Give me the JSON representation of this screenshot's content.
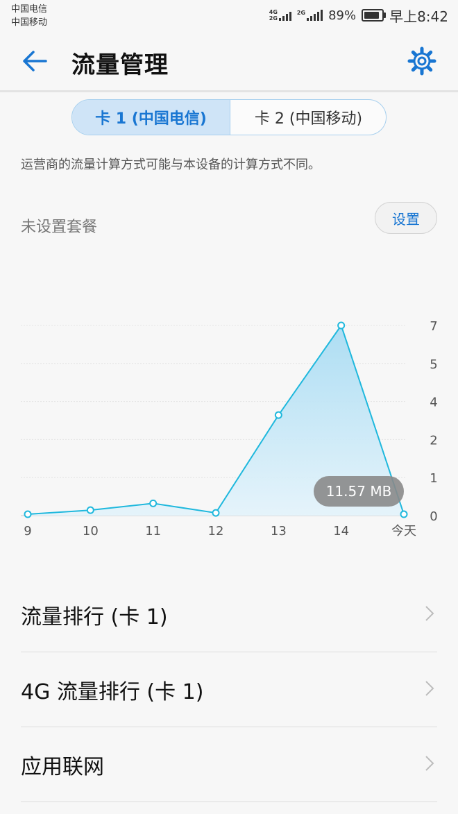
{
  "status_bar": {
    "carrier1": "中国电信",
    "carrier2": "中国移动",
    "net1_top": "4G",
    "net1_bottom": "2G",
    "net2": "2G",
    "battery": "89%",
    "battery_level": 0.89,
    "time": "早上8:42"
  },
  "app_bar": {
    "title": "流量管理",
    "back_icon": "back-arrow-icon",
    "settings_icon": "gear-icon"
  },
  "colors": {
    "accent": "#1976d2",
    "chart_line": "#1fb8dd",
    "tab_active_bg": "#cfe4f7"
  },
  "tabs": [
    {
      "label": "卡 1 (中国电信)",
      "active": true
    },
    {
      "label": "卡 2 (中国移动)",
      "active": false
    }
  ],
  "notice": "运营商的流量计算方式可能与本设备的计算方式不同。",
  "plan": {
    "label": "未设置套餐",
    "button": "设置"
  },
  "chart_data": {
    "type": "area",
    "x": [
      "9",
      "10",
      "11",
      "12",
      "13",
      "14",
      "今天"
    ],
    "values": [
      0.05,
      0.2,
      0.45,
      0.1,
      3.7,
      7.0,
      0.05
    ],
    "y_ticks": [
      "0",
      "1",
      "2",
      "4",
      "5",
      "7"
    ],
    "ylim": [
      0,
      7
    ],
    "grid": true,
    "tooltip": "11.57 MB"
  },
  "list": [
    {
      "label": "流量排行 (卡 1)"
    },
    {
      "label": "4G 流量排行 (卡 1)"
    },
    {
      "label": "应用联网"
    }
  ]
}
